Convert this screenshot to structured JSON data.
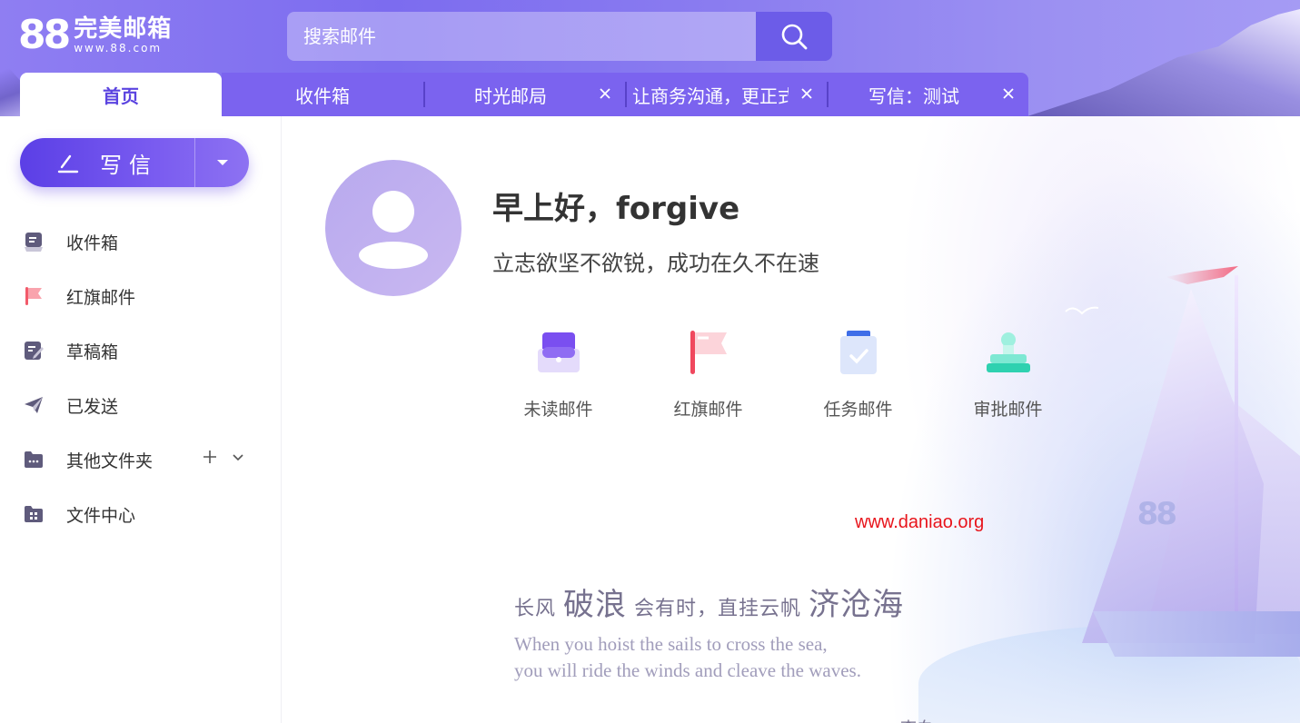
{
  "logo": {
    "number": "88",
    "title": "完美邮箱",
    "sub": "www.88.com"
  },
  "search": {
    "placeholder": "搜索邮件"
  },
  "tabs": [
    {
      "label": "首页",
      "active": true,
      "closable": false
    },
    {
      "label": "收件箱",
      "active": false,
      "closable": false
    },
    {
      "label": "时光邮局",
      "active": false,
      "closable": true
    },
    {
      "label": "让商务沟通，更正式",
      "active": false,
      "closable": true
    },
    {
      "label": "写信：测试",
      "active": false,
      "closable": true
    }
  ],
  "compose": {
    "label": "写信"
  },
  "sidebar": {
    "items": [
      {
        "label": "收件箱",
        "icon": "inbox-icon"
      },
      {
        "label": "红旗邮件",
        "icon": "red-flag-icon"
      },
      {
        "label": "草稿箱",
        "icon": "draft-icon"
      },
      {
        "label": "已发送",
        "icon": "send-icon"
      },
      {
        "label": "其他文件夹",
        "icon": "folder-icon"
      },
      {
        "label": "文件中心",
        "icon": "file-center-icon"
      }
    ]
  },
  "greeting": {
    "text": "早上好，forgive",
    "motto": "立志欲坚不欲锐，成功在久不在速"
  },
  "quick_links": [
    {
      "label": "未读邮件",
      "icon": "unread-mail-icon"
    },
    {
      "label": "红旗邮件",
      "icon": "flag-mail-icon"
    },
    {
      "label": "任务邮件",
      "icon": "task-mail-icon"
    },
    {
      "label": "审批邮件",
      "icon": "approval-mail-icon"
    }
  ],
  "watermark": "www.daniao.org",
  "poem": {
    "part1": "长风",
    "part2": "破浪",
    "part3": "会有时，直挂云帆",
    "part4": "济沧海",
    "en_line1": "When you hoist the sails to cross the sea,",
    "en_line2": "you will ride the winds and cleave the waves.",
    "author": "李白"
  },
  "colors": {
    "accent": "#6c5ce8",
    "brand_purple": "#7b63ef",
    "watermark": "#e8141b"
  }
}
